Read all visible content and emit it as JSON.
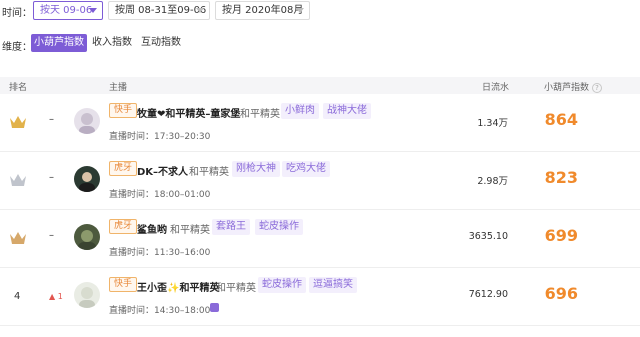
{
  "filters": {
    "time_label": "时间：",
    "by_day": "按天 09-06",
    "by_week": "按周 08-31至09-06",
    "by_month": "按月 2020年08月"
  },
  "dimensions": {
    "label": "维度：",
    "items": [
      "小葫芦指数",
      "收入指数",
      "互动指数"
    ]
  },
  "table": {
    "headers": {
      "rank": "排名",
      "anchor": "主播",
      "flow": "日流水",
      "index": "小葫芦指数"
    },
    "rows": [
      {
        "rank": "",
        "change": "–",
        "platform": "快手",
        "name": "牧童❤和平精英–童家堡",
        "game": "和平精英",
        "tags": [
          "小鲜肉",
          "战神大佬"
        ],
        "live_time": "直播时间：17:30–20:30",
        "flow": "1.34万",
        "index": "864"
      },
      {
        "rank": "",
        "change": "–",
        "platform": "虎牙",
        "name": "DK–不求人",
        "game": "和平精英",
        "tags": [
          "刚枪大神",
          "吃鸡大佬"
        ],
        "live_time": "直播时间：18:00–01:00",
        "flow": "2.98万",
        "index": "823"
      },
      {
        "rank": "",
        "change": "–",
        "platform": "虎牙",
        "name": "鲨鱼哟",
        "game": "和平精英",
        "tags": [
          "套路王",
          "蛇皮操作"
        ],
        "live_time": "直播时间：11:30–16:00",
        "flow": "3635.10",
        "index": "699"
      },
      {
        "rank": "4",
        "change": "1",
        "platform": "快手",
        "name": "王小歪✨和平精英",
        "game": "和平精英",
        "tags": [
          "蛇皮操作",
          "逗逼搞笑"
        ],
        "live_time": "直播时间：14:30–18:00",
        "flow": "7612.90",
        "index": "696"
      }
    ]
  },
  "colors": {
    "accent": "#7d5cd6",
    "index": "#f08a2c",
    "gold": "#e2b24a",
    "silver": "#c0c4cc",
    "bronze": "#d6a86a"
  }
}
